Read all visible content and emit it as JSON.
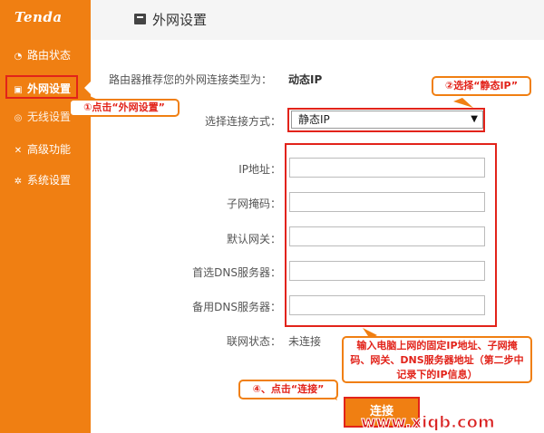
{
  "brand": {
    "logo": "Tenda"
  },
  "sidebar": {
    "items": [
      {
        "label": "路由状态",
        "icon": "dashboard-icon",
        "glyph": "◔"
      },
      {
        "label": "外网设置",
        "icon": "wan-icon",
        "glyph": "▣"
      },
      {
        "label": "无线设置",
        "icon": "wifi-icon",
        "glyph": "◎"
      },
      {
        "label": "高级功能",
        "icon": "tools-icon",
        "glyph": "✕"
      },
      {
        "label": "系统设置",
        "icon": "gear-icon",
        "glyph": "✲"
      }
    ]
  },
  "header": {
    "title": "外网设置",
    "icon": "wan-icon"
  },
  "main": {
    "recommend_label": "路由器推荐您的外网连接类型为：",
    "recommend_value": "动态IP",
    "conn_method_label": "选择连接方式：",
    "conn_method_value": "静态IP",
    "fields": [
      {
        "label": "IP地址：",
        "value": ""
      },
      {
        "label": "子网掩码：",
        "value": ""
      },
      {
        "label": "默认网关：",
        "value": ""
      },
      {
        "label": "首选DNS服务器：",
        "value": ""
      },
      {
        "label": "备用DNS服务器：",
        "value": ""
      }
    ],
    "status_label": "联网状态：",
    "status_value": "未连接",
    "connect_label": "连接"
  },
  "annotations": {
    "step1": "①点击“外网设置”",
    "step2": "②选择“静态IP”",
    "step3": "输入电脑上网的固定IP地址、子网掩码、网关、DNS服务器地址（第二步中记录下的IP信息）",
    "step4": "④、点击“连接”"
  },
  "watermark": "www.xiqb.com",
  "colors": {
    "brand_orange": "#f07f12",
    "annotation_red": "#e2231a"
  }
}
